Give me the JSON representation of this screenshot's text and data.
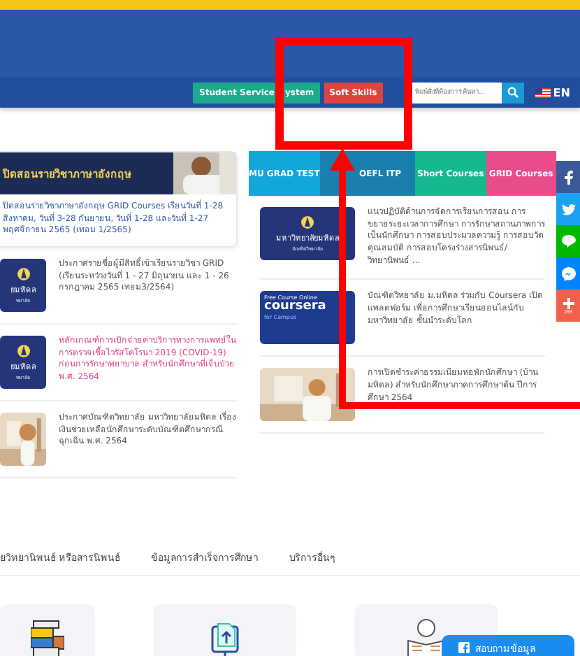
{
  "header": {
    "buttons": [
      {
        "label": "Student Service",
        "label_after_cover": "ystem",
        "color": "#1aab8a"
      },
      {
        "label": "Soft Skills",
        "color": "#e0443e"
      }
    ],
    "search": {
      "placeholder": "พิมพ์สิ่งที่ต้องการค้นหา..."
    },
    "language": "EN"
  },
  "featured": {
    "banner_title": "ปิดสอนรายวิชาภาษาอังกฤษ",
    "text": "ปิดสอนรายวิชาภาษาอังกฤษ GRID Courses เรียนวันที่ 1-28 สิงหาคม, วันที่ 3-28 กันยายน, วันที่ 1-28 และวันที่ 1-27 พฤศจิกายน 2565 (เทอม 1/2565)"
  },
  "left_news": [
    {
      "thumb": {
        "kind": "logo",
        "caption": "ยมหิดล",
        "subcaption": "ทยาลัย"
      },
      "title": "ประกาศรายชื่อผู้มีสิทธิ์เข้าเรียนรายวิชา GRID (เรียนระหว่างวันที่ 1 - 27 มิถุนายน และ 1 - 26 กรกฎาคม 2565 เทอม3/2564)",
      "highlighted": false
    },
    {
      "thumb": {
        "kind": "logo",
        "caption": "ยมหิดล",
        "subcaption": "ทยาลัย"
      },
      "title": "หลักเกณฑ์การเบิกจ่ายค่าบริการทางการแพทย์ในการตรวจเชื้อไวรัสโคโรนา 2019 (COVID-19) ก่อนการรักษาพยาบาล สำหรับนักศึกษาที่เจ็บป่วย พ.ศ. 2564",
      "highlighted": true
    },
    {
      "title": "ประกาศบัณฑิตวิทยาลัย มหาวิทยาลัยมหิดล เรื่อง เงินช่วยเหลือนักศึกษาระดับบัณฑิตศึกษากรณีฉุกเฉิน พ.ศ. 2564",
      "highlighted": false
    }
  ],
  "tabs": [
    {
      "label": "MU GRAD TEST",
      "color": "#13a6d8"
    },
    {
      "label": "OEFL ITP",
      "color": "#1b7fae"
    },
    {
      "label": "Short Courses",
      "color": "#16b98e"
    },
    {
      "label": "GRID Courses",
      "color": "#e84c8b"
    }
  ],
  "right_news": [
    {
      "thumb": {
        "kind": "logo",
        "caption": "มหาวิทยาลัยมหิดล",
        "subcaption": "บัณฑิตวิทยาลัย"
      },
      "title": "แนวปฏิบัติด้านการจัดการเรียนการสอน การขยายระยะเวลาการศึกษา การรักษาสถานภาพการเป็นนักศึกษา การสอบประมวลความรู้ การสอบวัดคุณสมบัติ การสอบโครงร่างสารนิพนธ์/วิทยานิพนธ์ ...",
      "highlighted": false
    },
    {
      "thumb": {
        "kind": "promo",
        "caption": "Free Course Online",
        "brand": "coursera",
        "subcaption": "for Campus"
      },
      "title": "บัณฑิตวิทยาลัย ม.มหิดล ร่วมกับ Coursera เปิดแพลตฟอร์ม เพื่อการศึกษาเรียนออนไลน์กับมหาวิทยาลัย ชั้นนำระดับโลก",
      "highlighted": false
    },
    {
      "title": "การเปิดชำระค่าธรรมเนียมหอพักนักศึกษา (บ้านมหิดล) สำหรับนักศึกษาภาคการศึกษาต้น ปีการศึกษา 2564",
      "highlighted": false
    }
  ],
  "social": [
    {
      "kind": "facebook",
      "color": "#3b5998"
    },
    {
      "kind": "twitter",
      "color": "#1da1f2"
    },
    {
      "kind": "line",
      "color": "#00b900"
    },
    {
      "kind": "messenger",
      "color": "#0084ff"
    },
    {
      "kind": "share",
      "color": "#f0614d",
      "count": "255"
    }
  ],
  "service_tabs": [
    "ยวิทยานิพนธ์ หรือสารนิพนธ์",
    "ข้อมูลการสำเร็จการศึกษา",
    "บริการอื่นๆ"
  ],
  "service_cards": [
    {
      "kind": "books"
    },
    {
      "kind": "upload"
    },
    {
      "kind": "idea"
    }
  ],
  "chat_button": "สอบถามข้อมูล",
  "annotations": {
    "highlight_box": true,
    "pointer_arrow": true
  }
}
